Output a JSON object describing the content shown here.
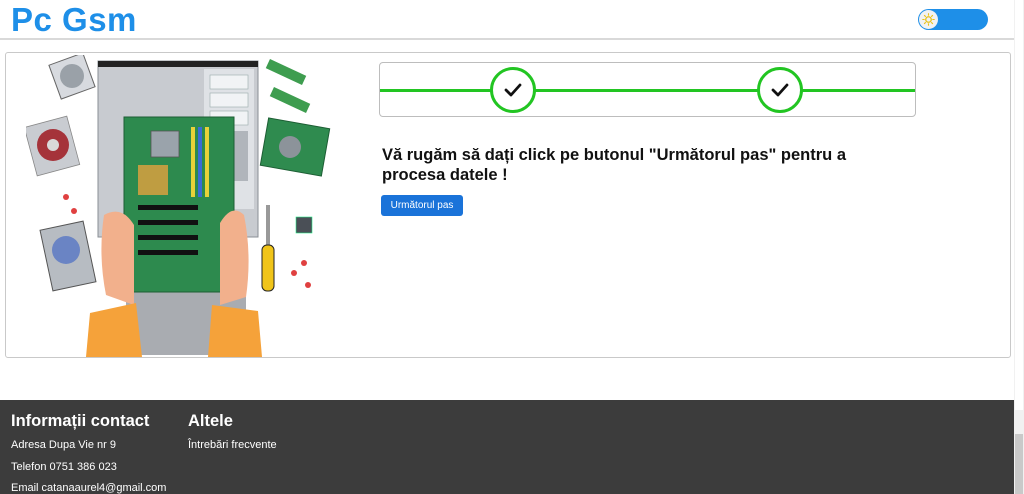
{
  "header": {
    "logo": "Pc Gsm",
    "theme_toggle_icon": "sun-icon"
  },
  "main": {
    "illustration_icon": "computer-repair-illustration",
    "stepper": {
      "steps_completed": 2,
      "step_icon": "check-icon"
    },
    "message": "Vă rugăm să dați click pe butonul \"Următorul pas\" pentru a procesa datele !",
    "next_button": "Următorul pas"
  },
  "footer": {
    "contact": {
      "heading": "Informații contact",
      "address": "Adresa Dupa Vie nr 9",
      "phone": "Telefon 0751 386 023",
      "email": "Email catanaaurel4@gmail.com"
    },
    "other": {
      "heading": "Altele",
      "faq": "Întrebări frecvente"
    }
  },
  "colors": {
    "accent": "#1e8fe8",
    "button": "#1a73d9",
    "success": "#22c522",
    "footer_bg": "#3c3c3c"
  }
}
